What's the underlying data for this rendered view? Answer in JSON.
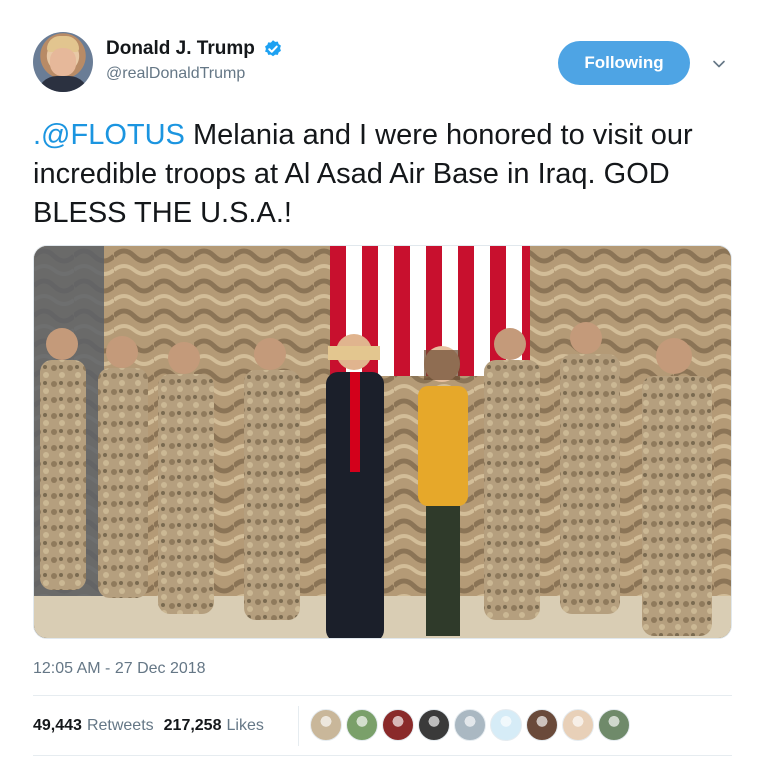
{
  "author": {
    "display_name": "Donald J. Trump",
    "handle": "@realDonaldTrump",
    "verified_icon": "verified-badge-icon",
    "avatar_icon": "profile-photo"
  },
  "follow_button": {
    "label": "Following",
    "color": "#4ea4e4"
  },
  "menu_icon": "chevron-down-icon",
  "tweet": {
    "mention": ".@FLOTUS",
    "text": " Melania and I were honored to visit our incredible troops at Al Asad Air Base in Iraq. GOD BLESS THE U.S.A.!",
    "mention_color": "#1b95e0"
  },
  "media": {
    "kind": "photo"
  },
  "timestamp": "12:05 AM - 27 Dec 2018",
  "stats": {
    "retweets_count": "49,443",
    "retweets_label": "Retweets",
    "likes_count": "217,258",
    "likes_label": "Likes"
  },
  "likers": [
    {
      "name": "liker-avatar-1",
      "color": "#c9b79a"
    },
    {
      "name": "liker-avatar-2",
      "color": "#7aa06a"
    },
    {
      "name": "liker-avatar-3",
      "color": "#8a2a2a"
    },
    {
      "name": "liker-avatar-4",
      "color": "#3a3a3a"
    },
    {
      "name": "liker-avatar-5",
      "color": "#aab8c2"
    },
    {
      "name": "liker-avatar-6",
      "color": "#d6ecf7"
    },
    {
      "name": "liker-avatar-7",
      "color": "#6a4a3a"
    },
    {
      "name": "liker-avatar-8",
      "color": "#e8d0b8"
    },
    {
      "name": "liker-avatar-9",
      "color": "#6f8a6a"
    }
  ]
}
